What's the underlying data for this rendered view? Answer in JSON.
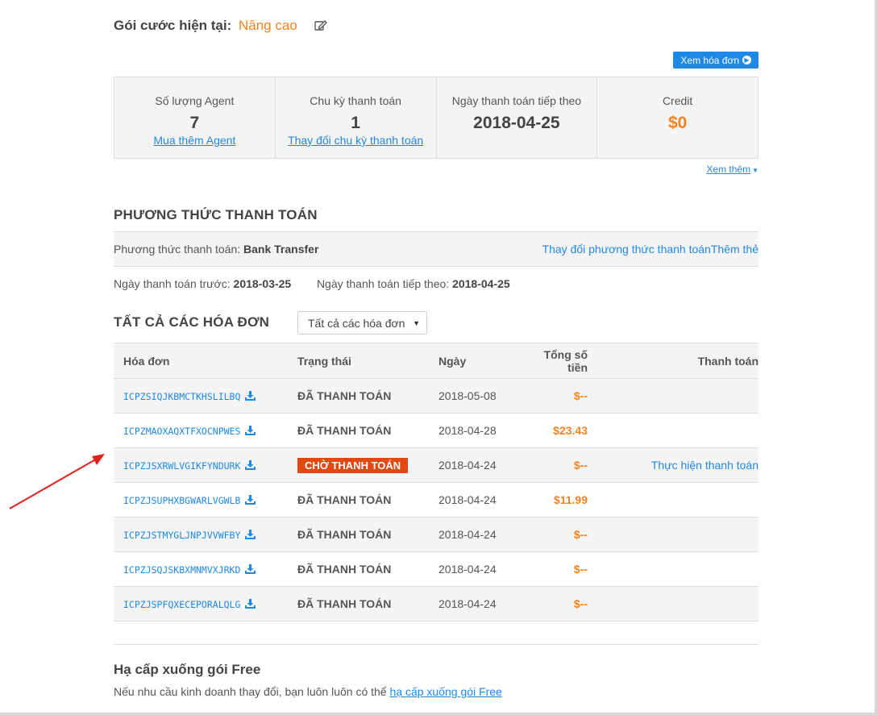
{
  "plan": {
    "label": "Gói cước hiện tại:",
    "name": "Nâng cao"
  },
  "invoice_button": {
    "label": "Xem hóa đơn"
  },
  "stats": [
    {
      "label": "Số lượng Agent",
      "value": "7",
      "link": "Mua thêm Agent"
    },
    {
      "label": "Chu kỳ thanh toán",
      "value": "1",
      "link": "Thay đổi chu kỳ thanh toán"
    },
    {
      "label": "Ngày thanh toán tiếp theo",
      "value": "2018-04-25"
    },
    {
      "label": "Credit",
      "value": "$0"
    }
  ],
  "see_more": "Xem thêm",
  "payment_method": {
    "title": "PHƯƠNG THỨC THANH TOÁN",
    "label": "Phương thức thanh toán:",
    "value": "Bank Transfer",
    "change_link": "Thay đổi phương thức thanh toán",
    "add_card_link": "Thêm thẻ",
    "prev_date_label": "Ngày thanh toán trước:",
    "prev_date": "2018-03-25",
    "next_date_label": "Ngày thanh toán tiếp theo:",
    "next_date": "2018-04-25"
  },
  "invoices": {
    "title": "TẤT CẢ CÁC HÓA ĐƠN",
    "filter_selected": "Tất cả các hóa đơn",
    "columns": [
      "Hóa đơn",
      "Trạng thái",
      "Ngày",
      "Tổng số tiền",
      "Thanh toán"
    ],
    "rows": [
      {
        "code": "ICPZSIQJKBMCTKHSLILBQ",
        "status": "ĐÃ THANH TOÁN",
        "date": "2018-05-08",
        "total": "$--",
        "pay": ""
      },
      {
        "code": "ICPZMAOXAQXTFXOCNPWES",
        "status": "ĐÃ THANH TOÁN",
        "date": "2018-04-28",
        "total": "$23.43",
        "pay": ""
      },
      {
        "code": "ICPZJSXRWLVGIKFYNDURK",
        "status": "CHỜ THANH TOÁN",
        "date": "2018-04-24",
        "total": "$--",
        "pay": "Thực hiện thanh toán"
      },
      {
        "code": "ICPZJSUPHXBGWARLVGWLB",
        "status": "ĐÃ THANH TOÁN",
        "date": "2018-04-24",
        "total": "$11.99",
        "pay": ""
      },
      {
        "code": "ICPZJSTMYGLJNPJVVWFBY",
        "status": "ĐÃ THANH TOÁN",
        "date": "2018-04-24",
        "total": "$--",
        "pay": ""
      },
      {
        "code": "ICPZJSQJSKBXMNMVXJRKD",
        "status": "ĐÃ THANH TOÁN",
        "date": "2018-04-24",
        "total": "$--",
        "pay": ""
      },
      {
        "code": "ICPZJSPFQXECEPORALQLG",
        "status": "ĐÃ THANH TOÁN",
        "date": "2018-04-24",
        "total": "$--",
        "pay": ""
      }
    ]
  },
  "downgrade": {
    "title": "Hạ cấp xuống gói Free",
    "text": "Nếu nhu cầu kinh doanh thay đổi, bạn luôn luôn có thể",
    "link": "hạ cấp xuống gói Free"
  },
  "icons": {
    "edit": "edit-icon",
    "download": "download-icon",
    "arrow_right_circle": "arrow-right-circle-icon",
    "caret_down": "caret-down-icon",
    "annotation_arrow": "red-arrow-annotation"
  },
  "colors": {
    "accent_blue": "#1e88e5",
    "orange": "#f5821f",
    "pending_red": "#e04a12",
    "arrow_red": "#e0201a"
  }
}
